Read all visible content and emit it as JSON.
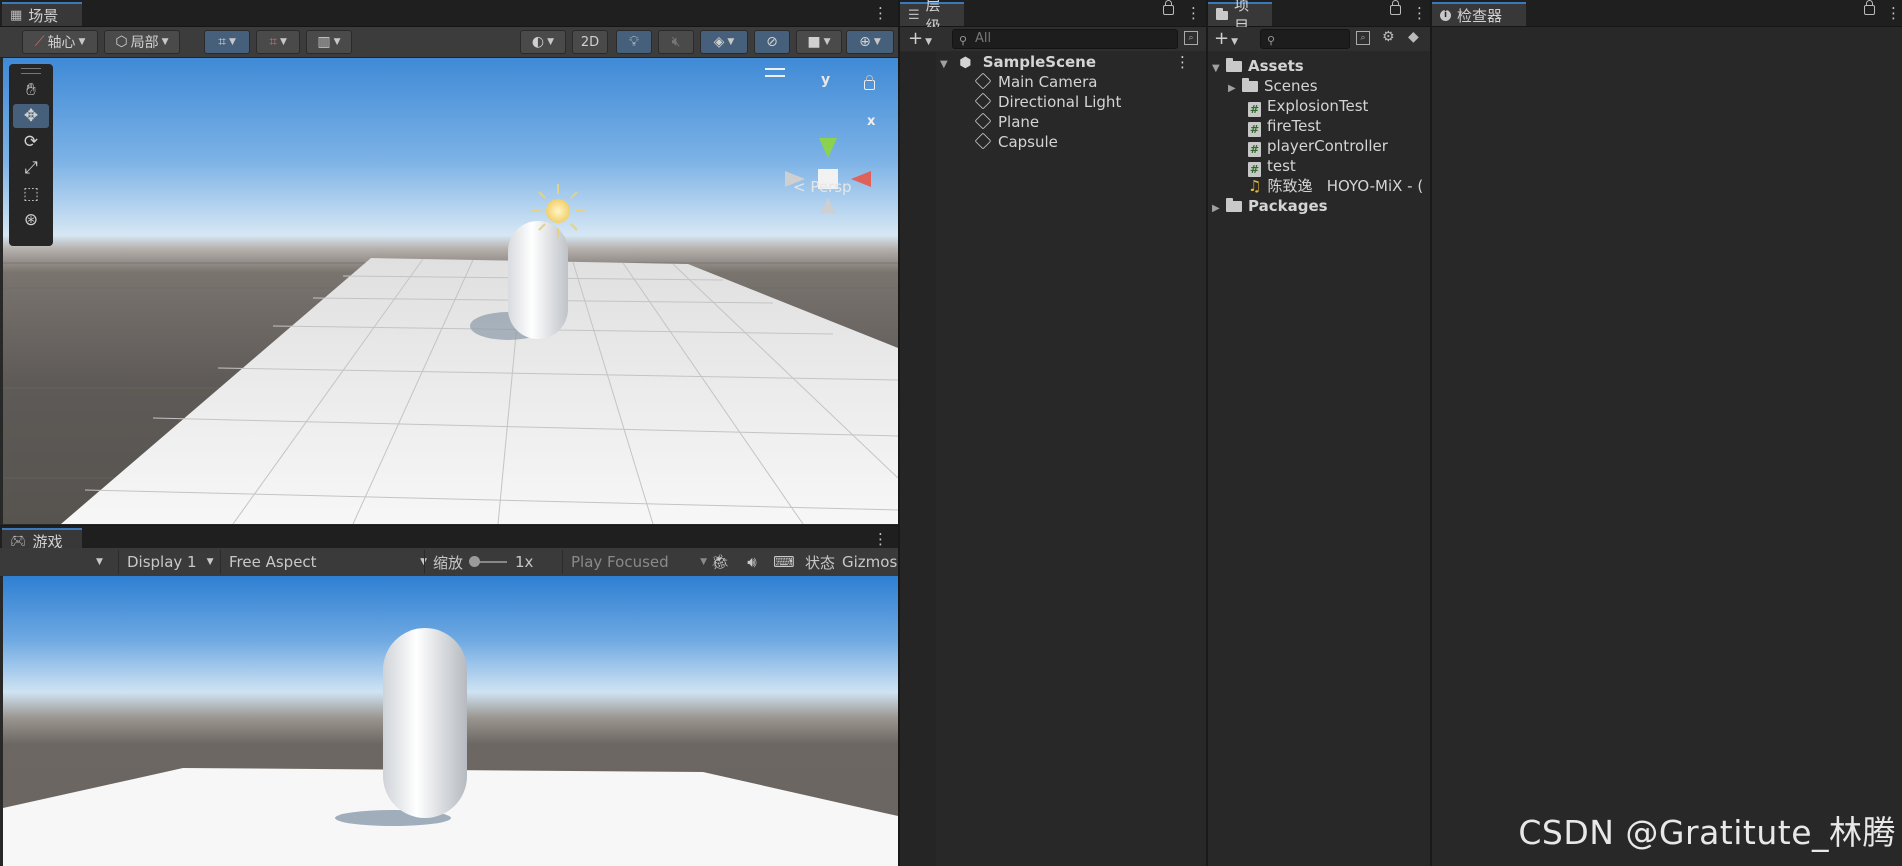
{
  "scene": {
    "tab": "场景",
    "pivot_label": "轴心",
    "local_label": "局部",
    "btn_2d": "2D",
    "persp_label": "< Persp",
    "gizmo_y": "y",
    "gizmo_x": "x"
  },
  "game": {
    "tab": "游戏",
    "display": "Display 1",
    "aspect": "Free Aspect",
    "scale_label": "缩放",
    "scale_value": "1x",
    "play_mode": "Play Focused",
    "stats_label": "状态",
    "gizmos_label": "Gizmos"
  },
  "hierarchy": {
    "tab": "层级",
    "search_placeholder": "All",
    "scene_name": "SampleScene",
    "items": [
      "Main Camera",
      "Directional Light",
      "Plane",
      "Capsule"
    ]
  },
  "project": {
    "tab": "项目",
    "assets_label": "Assets",
    "scenes_label": "Scenes",
    "scripts": [
      "ExplosionTest",
      "fireTest",
      "playerController",
      "test"
    ],
    "audio_name": "陈致逸",
    "audio_rest": "HOYO-MiX - (",
    "packages_label": "Packages"
  },
  "inspector": {
    "tab": "检查器"
  },
  "watermark": "CSDN @Gratitute_林腾",
  "colors": {
    "accent": "#3a79bb",
    "active_button": "#46607c",
    "panel_bg": "#282828"
  }
}
